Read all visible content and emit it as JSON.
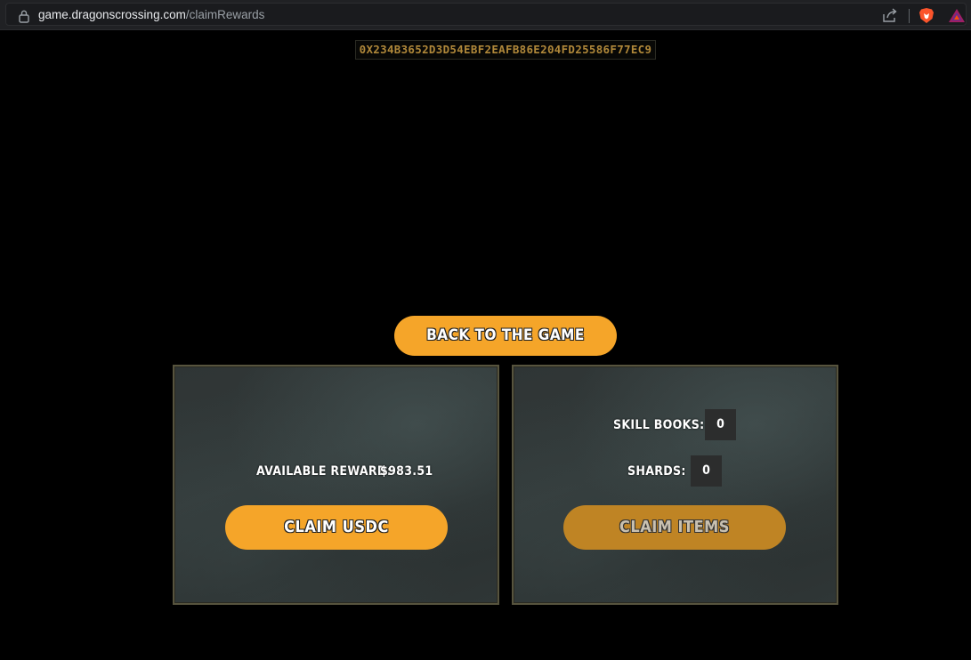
{
  "browser": {
    "url_host": "game.dragonscrossing.com",
    "url_path": "/claimRewards",
    "icons": [
      "lock-icon",
      "share-icon",
      "brave-shield-icon",
      "bat-rewards-icon"
    ]
  },
  "wallet": {
    "address": "0X234B3652D3D54EBF2EAFB86E204FD25586F77EC9"
  },
  "nav": {
    "back_label": "BACK TO THE GAME"
  },
  "usdc_panel": {
    "reward_label": "AVAILABLE REWARD:",
    "reward_value": "$983.51",
    "claim_label": "CLAIM USDC"
  },
  "items_panel": {
    "skill_books_label": "SKILL BOOKS:",
    "skill_books_value": "0",
    "shards_label": "SHARDS:",
    "shards_value": "0",
    "claim_label": "CLAIM ITEMS"
  },
  "colors": {
    "accent": "#f5a529",
    "accent_disabled": "#bf8424",
    "address_text": "#b0883a",
    "panel_border": "#57543e"
  }
}
